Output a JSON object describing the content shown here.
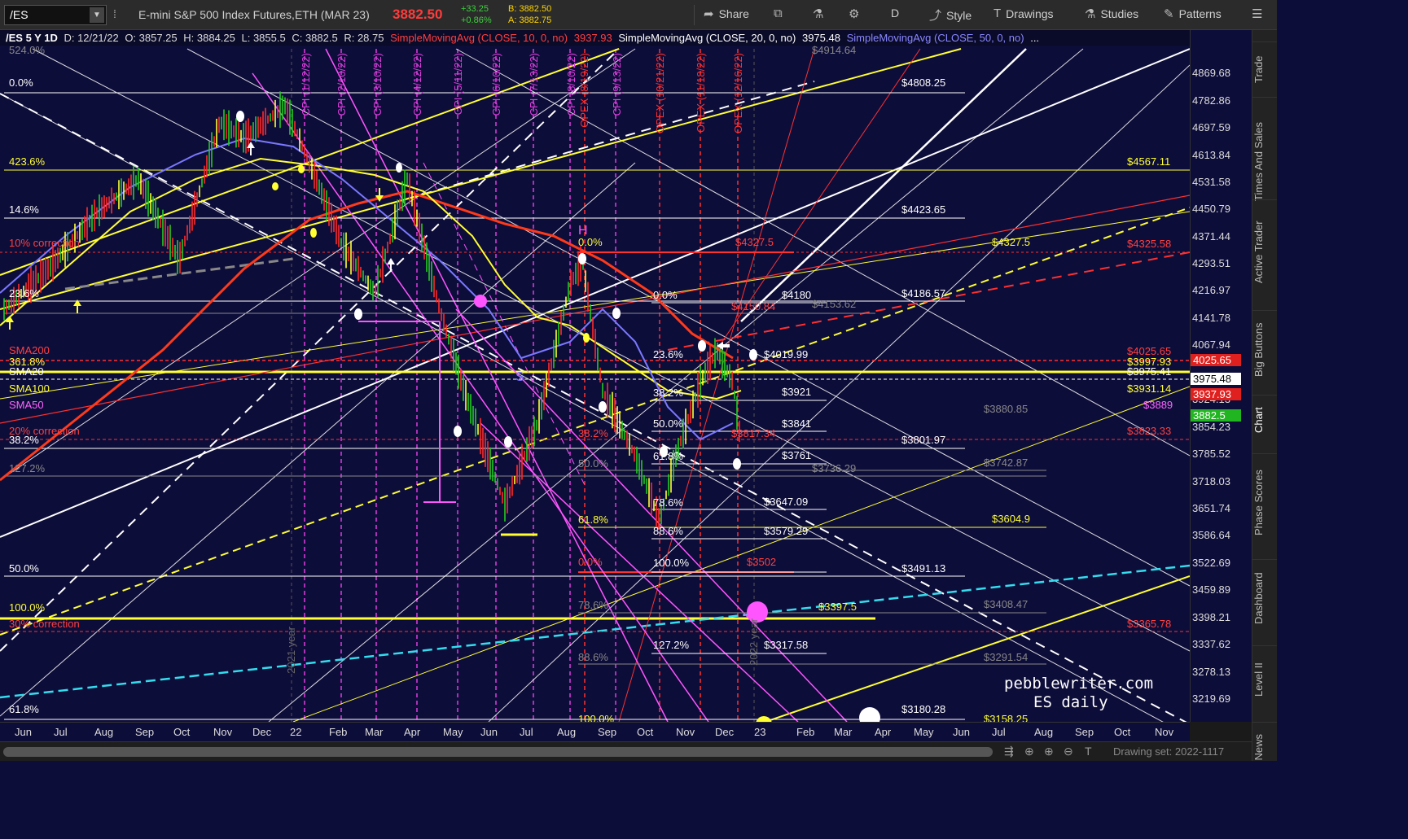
{
  "toolbar": {
    "symbol": "/ES",
    "description": "E-mini S&P 500 Index Futures,ETH (MAR 23)",
    "last_price": "3882.50",
    "net_change": "+33.25",
    "pct_change": "+0.86%",
    "bid": "B: 3882.50",
    "ask": "A: 3882.75",
    "share_label": "Share",
    "period_label": "D",
    "style_label": "Style",
    "drawings_label": "Drawings",
    "studies_label": "Studies",
    "patterns_label": "Patterns"
  },
  "study_header": {
    "chart_id": "/ES 5 Y 1D",
    "date": "D: 12/21/22",
    "open": "O: 3857.25",
    "high": "H: 3884.25",
    "low": "L: 3855.5",
    "close": "C: 3882.5",
    "range": "R: 28.75",
    "sma10_label": "SimpleMovingAvg (CLOSE, 10, 0, no)",
    "sma10_value": "3937.93",
    "sma20_label": "SimpleMovingAvg (CLOSE, 20, 0, no)",
    "sma20_value": "3975.48",
    "sma50_label": "SimpleMovingAvg (CLOSE, 50, 0, no)",
    "more": "..."
  },
  "price_axis": {
    "ticks": [
      "4869.68",
      "4782.86",
      "4697.59",
      "4613.84",
      "4531.58",
      "4450.79",
      "4371.44",
      "4293.51",
      "4216.97",
      "4141.78",
      "4067.94",
      "3924.13",
      "3854.23",
      "3785.52",
      "3718.03",
      "3651.74",
      "3586.64",
      "3522.69",
      "3459.89",
      "3398.21",
      "3337.62",
      "3278.13",
      "3219.69"
    ],
    "tags": [
      {
        "text": "4025.65",
        "bg": "#e0201e",
        "fg": "#ffffff"
      },
      {
        "text": "3975.48",
        "bg": "#ffffff",
        "fg": "#000000"
      },
      {
        "text": "3937.93",
        "bg": "#e0201e",
        "fg": "#ffffff"
      },
      {
        "text": "3882.5",
        "bg": "#22b522",
        "fg": "#ffffff"
      }
    ]
  },
  "time_axis": [
    "Jun",
    "Jul",
    "Aug",
    "Sep",
    "Oct",
    "Nov",
    "Dec",
    "22",
    "Feb",
    "Mar",
    "Apr",
    "May",
    "Jun",
    "Jul",
    "Aug",
    "Sep",
    "Oct",
    "Nov",
    "Dec",
    "23",
    "Feb",
    "Mar",
    "Apr",
    "May",
    "Jun",
    "Jul",
    "Aug",
    "Sep",
    "Oct",
    "Nov"
  ],
  "right_tabs": [
    "Trade",
    "Times And Sales",
    "Active Trader",
    "Big Buttons",
    "Chart",
    "Phase Scores",
    "Dashboard",
    "Level II",
    "Live News"
  ],
  "annotations": {
    "left_fibs": [
      "0.0%",
      "423.6%",
      "14.6%",
      "10% correction",
      "23.6%",
      "361.8%",
      "SMA200",
      "SMA20",
      "SMA100",
      "SMA50",
      "20% correction",
      "38.2%",
      "127.2%",
      "50.0%",
      "100.0%",
      "30% correction",
      "61.8%",
      "524.0%"
    ],
    "right_levels": [
      "$4808.25",
      "$4567.11",
      "$4423.65",
      "$4327.5",
      "$4325.58",
      "$4186.57",
      "$4180",
      "$4153.62",
      "$4150.84",
      "$4025.65",
      "$4019.99",
      "$3997.93",
      "$3975.41",
      "$3931.14",
      "$3921",
      "$3880.85",
      "$3889",
      "$3841",
      "$3823.33",
      "$3817.34",
      "$3801.97",
      "$3761",
      "$3742.87",
      "$3736.29",
      "$3647.09",
      "$3604.9",
      "$3579.29",
      "$3502",
      "$3491.13",
      "$3408.47",
      "$3397.5",
      "$3365.78",
      "$3317.58",
      "$3291.54",
      "$3180.28",
      "$3158.25",
      "$4914.64",
      "$4327.5"
    ],
    "mid_fibs": [
      "0.0%",
      "23.6%",
      "38.2%",
      "50.0%",
      "61.8%",
      "78.6%",
      "88.6%",
      "100.0%",
      "127.2%",
      "61.8%",
      "50.0%",
      "0.0%",
      "78.6%",
      "88.6%",
      "100.0%",
      "38.2%",
      "0.0%"
    ],
    "vertical_labels": [
      "CPI (1/12/22)",
      "CPI (2/10/22)",
      "CPI (3/10/22)",
      "CPI (4/12/22)",
      "CPI (5/11/22)",
      "CPI (6/10/22)",
      "CPI (7/13/22)",
      "CPI (8/10/22)",
      "OPEX (8/19/22)",
      "CPI (9/13/22)",
      "OPEX (10/21/22)",
      "OPEX (11/18/22)",
      "OPEX (12/16/22)",
      "2021 year",
      "2022 year"
    ],
    "marker_letters": [
      "H",
      "S"
    ]
  },
  "watermark": {
    "line1": "pebblewriter.com",
    "line2": "ES daily"
  },
  "bottom_bar": {
    "drawing_set": "Drawing set: 2022-1117"
  }
}
